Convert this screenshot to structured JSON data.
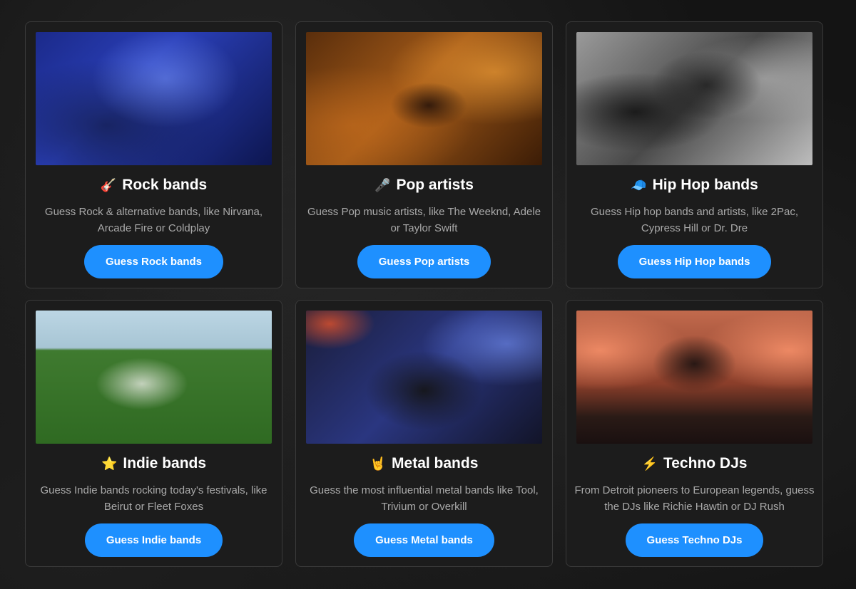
{
  "cards": [
    {
      "title": "Rock bands",
      "icon": "guitar-icon",
      "emoji": "🎸",
      "description": "Guess Rock & alternative bands, like Nirvana, Arcade Fire or Coldplay",
      "button_label": "Guess Rock bands"
    },
    {
      "title": "Pop artists",
      "icon": "microphone-icon",
      "emoji": "🎤",
      "description": "Guess Pop music artists, like The Weeknd, Adele or Taylor Swift",
      "button_label": "Guess Pop artists"
    },
    {
      "title": "Hip Hop bands",
      "icon": "cap-icon",
      "emoji": "🧢",
      "description": "Guess Hip hop bands and artists, like 2Pac, Cypress Hill or Dr. Dre",
      "button_label": "Guess Hip Hop bands"
    },
    {
      "title": "Indie bands",
      "icon": "star-icon",
      "emoji": "⭐",
      "description": "Guess Indie bands rocking today's festivals, like Beirut or Fleet Foxes",
      "button_label": "Guess Indie bands"
    },
    {
      "title": "Metal bands",
      "icon": "rock-hand-icon",
      "emoji": "🤘",
      "description": "Guess the most influential metal bands like Tool, Trivium or Overkill",
      "button_label": "Guess Metal bands"
    },
    {
      "title": "Techno DJs",
      "icon": "lightning-icon",
      "emoji": "⚡",
      "description": "From Detroit pioneers to European legends, guess the DJs like Richie Hawtin or DJ Rush",
      "button_label": "Guess Techno DJs"
    }
  ],
  "colors": {
    "button": "#1e90ff",
    "card_bg": "#1c1c1c",
    "description_text": "#a9a9a9"
  }
}
